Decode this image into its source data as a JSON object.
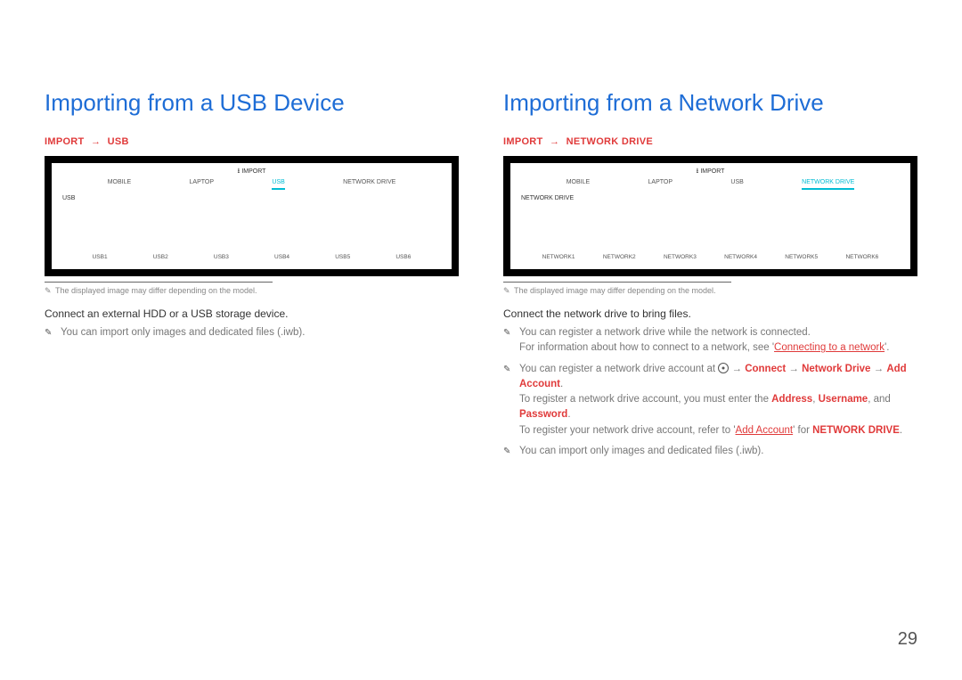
{
  "pageNumber": "29",
  "left": {
    "heading": "Importing from a USB Device",
    "breadcrumb": {
      "a": "IMPORT",
      "arrow": "→",
      "b": "USB"
    },
    "mock": {
      "importLabel": "IMPORT",
      "tabs": [
        "MOBILE",
        "LAPTOP",
        "USB",
        "NETWORK DRIVE"
      ],
      "activeIndex": 2,
      "sublabel": "USB",
      "items": [
        "USB1",
        "USB2",
        "USB3",
        "USB4",
        "USB5",
        "USB6"
      ]
    },
    "footnote": "The displayed image may differ depending on the model.",
    "body": "Connect an external HDD or a USB storage device.",
    "notes": {
      "n1": "You can import only images and dedicated files (.iwb)."
    }
  },
  "right": {
    "heading": "Importing from a Network Drive",
    "breadcrumb": {
      "a": "IMPORT",
      "arrow": "→",
      "b": "NETWORK DRIVE"
    },
    "mock": {
      "importLabel": "IMPORT",
      "tabs": [
        "MOBILE",
        "LAPTOP",
        "USB",
        "NETWORK DRIVE"
      ],
      "activeIndex": 3,
      "sublabel": "NETWORK DRIVE",
      "items": [
        "NETWORK1",
        "NETWORK2",
        "NETWORK3",
        "NETWORK4",
        "NETWORK5",
        "NETWORK6"
      ]
    },
    "footnote": "The displayed image may differ depending on the model.",
    "body": "Connect the network drive to bring files.",
    "notes": {
      "n1a": "You can register a network drive while the network is connected.",
      "n1b_prefix": "For information about how to connect to a network, see '",
      "n1b_link": "Connecting to a network",
      "n1b_suffix": "'.",
      "n2a_prefix": "You can register a network drive account at ",
      "n2a_arrow": " → ",
      "n2a_connect": "Connect",
      "n2a_nd": "Network Drive",
      "n2a_aa": "Add Account",
      "n2a_period": ".",
      "n2b_prefix": "To register a network drive account, you must enter the ",
      "n2b_address": "Address",
      "n2b_comma1": ", ",
      "n2b_username": "Username",
      "n2b_comma2": ", and ",
      "n2b_password": "Password",
      "n2b_period": ".",
      "n2c_prefix": "To register your network drive account, refer to '",
      "n2c_link": "Add Account",
      "n2c_mid": "' for ",
      "n2c_nd": "NETWORK DRIVE",
      "n2c_period": ".",
      "n3": "You can import only images and dedicated files (.iwb)."
    }
  }
}
